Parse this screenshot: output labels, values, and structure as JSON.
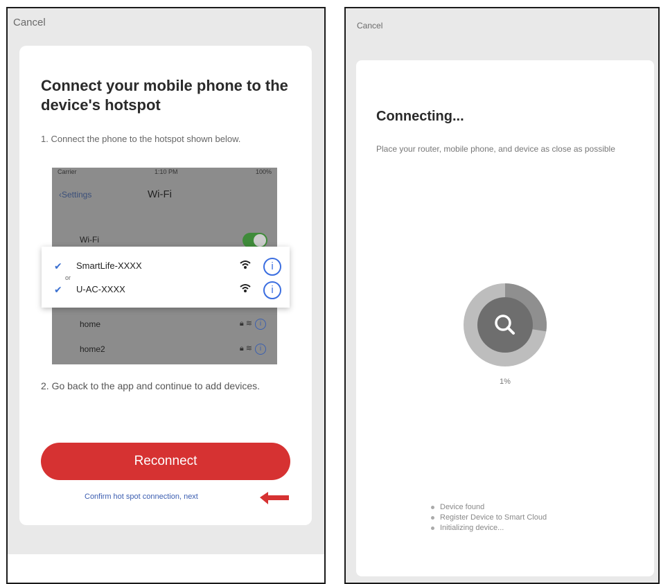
{
  "left": {
    "cancel_label": "Cancel",
    "title": "Connect your mobile phone to the device's hotspot",
    "step1": "1. Connect the phone to the hotspot shown below.",
    "mock": {
      "status_left": "Carrier",
      "status_time": "1:10 PM",
      "status_right": "100%",
      "back_label": "Settings",
      "wifi_title": "Wi-Fi",
      "wifi_label": "Wi-Fi",
      "wifi_enabled": true,
      "networks": [
        "home",
        "home2"
      ],
      "popup_ssids": [
        "SmartLife-XXXX",
        "U-AC-XXXX"
      ],
      "popup_or": "or"
    },
    "step2": "2. Go back to the app and continue to add devices.",
    "reconnect_label": "Reconnect",
    "confirm_link": "Confirm hot spot connection, next",
    "accent_color": "#d63232"
  },
  "right": {
    "cancel_label": "Cancel",
    "title": "Connecting...",
    "description": "Place your router, mobile phone, and device as close as possible",
    "progress_percent": 1,
    "progress_label": "1%",
    "status_items": [
      "Device found",
      "Register Device to Smart Cloud",
      "Initializing device..."
    ]
  }
}
